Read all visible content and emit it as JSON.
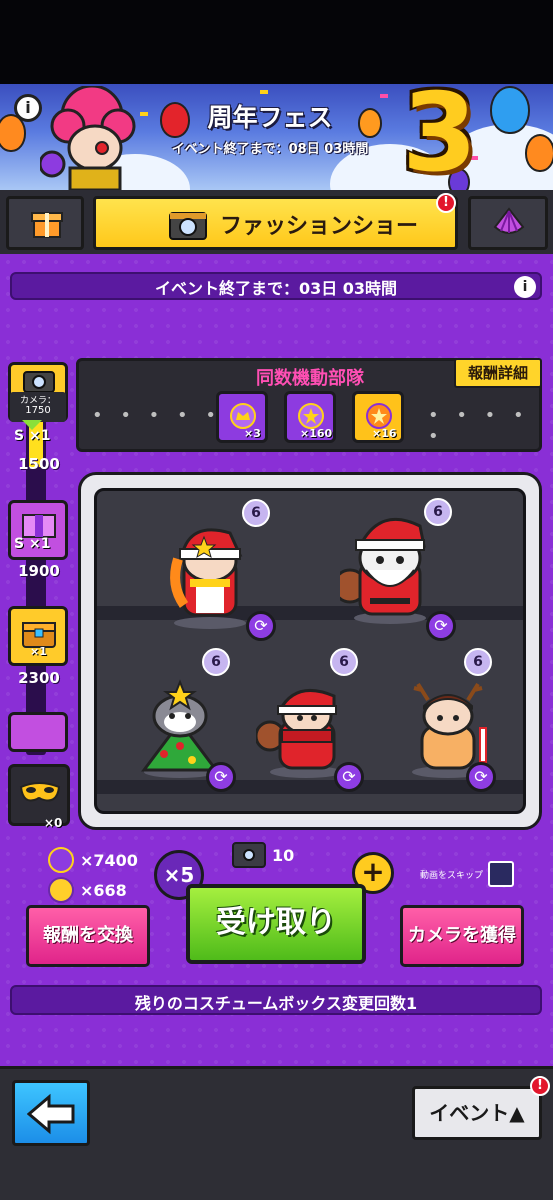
{
  "banner": {
    "title": "周年フェス",
    "subtitle": "イベント終了まで：08日 03時間",
    "anniversary_number": "3",
    "info_glyph": "i"
  },
  "tabs": {
    "gift_icon": "gift-icon",
    "active_label": "ファッションショー",
    "active_badge": "!",
    "shell_icon": "shell-icon"
  },
  "event": {
    "timer_text": "イベント終了まで：03日 03時間",
    "info_glyph": "i"
  },
  "milestones": {
    "camera_label": "カメラ：",
    "camera_value": "1750",
    "items": [
      {
        "label": "1500",
        "sub": "S ×1"
      },
      {
        "label": "1900",
        "sub": "S ×1"
      },
      {
        "label": "2300",
        "sub": "×1"
      }
    ],
    "mask_count": "×0",
    "progress_fraction": 0.2
  },
  "squad": {
    "title": "同数機動部隊",
    "reward_detail": "報酬詳細",
    "dots": "• • • • •",
    "medals": [
      {
        "count": "×3",
        "color": "#8d3be0"
      },
      {
        "count": "×160",
        "color": "#8d3be0"
      },
      {
        "count": "×16",
        "color": "#ffc21a"
      }
    ]
  },
  "costumes": [
    {
      "level": "6",
      "name": "girl-santa"
    },
    {
      "level": "6",
      "name": "santa-cat"
    },
    {
      "level": "6",
      "name": "tree-cat"
    },
    {
      "level": "6",
      "name": "santa-scarf"
    },
    {
      "level": "6",
      "name": "reindeer"
    }
  ],
  "currency": {
    "purple_medal": "×7400",
    "gold_medal": "×668",
    "multiplier": "×5",
    "camera_count": "10",
    "plus": "+",
    "skip_label": "動画をスキップ"
  },
  "actions": {
    "exchange": "報酬を交換",
    "receive": "受け取り",
    "get_camera": "カメラを獲得"
  },
  "remaining": "残りのコスチュームボックス変更回数1",
  "footer": {
    "event_label": "イベント",
    "event_badge": "!"
  }
}
